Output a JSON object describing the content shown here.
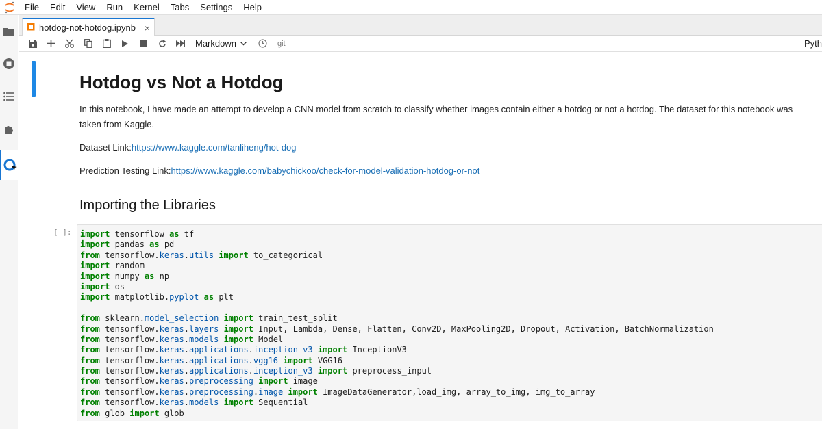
{
  "menu": [
    "File",
    "Edit",
    "View",
    "Run",
    "Kernel",
    "Tabs",
    "Settings",
    "Help"
  ],
  "tab": {
    "title": "hotdog-not-hotdog.ipynb",
    "close": "×"
  },
  "toolbar": {
    "cell_type": "Markdown",
    "git_label": "git",
    "kernel": "Pyth"
  },
  "icons": {
    "sidebar": [
      "folder-icon",
      "running-icon",
      "toc-icon",
      "extension-icon",
      "git-icon"
    ],
    "toolbar": [
      "save-icon",
      "add-icon",
      "cut-icon",
      "copy-icon",
      "paste-icon",
      "run-icon",
      "stop-icon",
      "restart-icon",
      "fast-forward-icon",
      "clock-icon"
    ]
  },
  "colors": {
    "accent": "#1976d2",
    "link": "#1a6fb5",
    "keyword": "#008000",
    "module": "#0055aa"
  },
  "cells": {
    "heading": "Hotdog vs Not a Hotdog",
    "intro_line1": "In this notebook, I have made an attempt to develop a CNN model from scratch to classify whether images contain either a hotdog or not a hotdog. The dataset for this notebook was",
    "intro_line2": "taken from Kaggle.",
    "dataset_label": "Dataset Link:",
    "dataset_url": "https://www.kaggle.com/tanliheng/hot-dog",
    "prediction_label": "Prediction Testing Link:",
    "prediction_url": "https://www.kaggle.com/babychickoo/check-for-model-validation-hotdog-or-not",
    "section_heading": "Importing the Libraries",
    "prompt": "[ ]:",
    "code_lines": [
      [
        [
          "kw",
          "import"
        ],
        [
          "t",
          " tensorflow "
        ],
        [
          "kw",
          "as"
        ],
        [
          "t",
          " tf"
        ]
      ],
      [
        [
          "kw",
          "import"
        ],
        [
          "t",
          " pandas "
        ],
        [
          "kw",
          "as"
        ],
        [
          "t",
          " pd"
        ]
      ],
      [
        [
          "kw",
          "from"
        ],
        [
          "t",
          " tensorflow."
        ],
        [
          "mod",
          "keras"
        ],
        [
          "t",
          "."
        ],
        [
          "mod",
          "utils"
        ],
        [
          "t",
          " "
        ],
        [
          "kw",
          "import"
        ],
        [
          "t",
          " to_categorical"
        ]
      ],
      [
        [
          "kw",
          "import"
        ],
        [
          "t",
          " random"
        ]
      ],
      [
        [
          "kw",
          "import"
        ],
        [
          "t",
          " numpy "
        ],
        [
          "kw",
          "as"
        ],
        [
          "t",
          " np"
        ]
      ],
      [
        [
          "kw",
          "import"
        ],
        [
          "t",
          " os"
        ]
      ],
      [
        [
          "kw",
          "import"
        ],
        [
          "t",
          " matplotlib."
        ],
        [
          "mod",
          "pyplot"
        ],
        [
          "t",
          " "
        ],
        [
          "kw",
          "as"
        ],
        [
          "t",
          " plt"
        ]
      ],
      [],
      [
        [
          "kw",
          "from"
        ],
        [
          "t",
          " sklearn."
        ],
        [
          "mod",
          "model_selection"
        ],
        [
          "t",
          " "
        ],
        [
          "kw",
          "import"
        ],
        [
          "t",
          " train_test_split"
        ]
      ],
      [
        [
          "kw",
          "from"
        ],
        [
          "t",
          " tensorflow."
        ],
        [
          "mod",
          "keras"
        ],
        [
          "t",
          "."
        ],
        [
          "mod",
          "layers"
        ],
        [
          "t",
          " "
        ],
        [
          "kw",
          "import"
        ],
        [
          "t",
          " Input, Lambda, Dense, Flatten, Conv2D, MaxPooling2D, Dropout, Activation, BatchNormalization"
        ]
      ],
      [
        [
          "kw",
          "from"
        ],
        [
          "t",
          " tensorflow."
        ],
        [
          "mod",
          "keras"
        ],
        [
          "t",
          "."
        ],
        [
          "mod",
          "models"
        ],
        [
          "t",
          " "
        ],
        [
          "kw",
          "import"
        ],
        [
          "t",
          " Model"
        ]
      ],
      [
        [
          "kw",
          "from"
        ],
        [
          "t",
          " tensorflow."
        ],
        [
          "mod",
          "keras"
        ],
        [
          "t",
          "."
        ],
        [
          "mod",
          "applications"
        ],
        [
          "t",
          "."
        ],
        [
          "mod",
          "inception_v3"
        ],
        [
          "t",
          " "
        ],
        [
          "kw",
          "import"
        ],
        [
          "t",
          " InceptionV3"
        ]
      ],
      [
        [
          "kw",
          "from"
        ],
        [
          "t",
          " tensorflow."
        ],
        [
          "mod",
          "keras"
        ],
        [
          "t",
          "."
        ],
        [
          "mod",
          "applications"
        ],
        [
          "t",
          "."
        ],
        [
          "mod",
          "vgg16"
        ],
        [
          "t",
          " "
        ],
        [
          "kw",
          "import"
        ],
        [
          "t",
          " VGG16"
        ]
      ],
      [
        [
          "kw",
          "from"
        ],
        [
          "t",
          " tensorflow."
        ],
        [
          "mod",
          "keras"
        ],
        [
          "t",
          "."
        ],
        [
          "mod",
          "applications"
        ],
        [
          "t",
          "."
        ],
        [
          "mod",
          "inception_v3"
        ],
        [
          "t",
          " "
        ],
        [
          "kw",
          "import"
        ],
        [
          "t",
          " preprocess_input"
        ]
      ],
      [
        [
          "kw",
          "from"
        ],
        [
          "t",
          " tensorflow."
        ],
        [
          "mod",
          "keras"
        ],
        [
          "t",
          "."
        ],
        [
          "mod",
          "preprocessing"
        ],
        [
          "t",
          " "
        ],
        [
          "kw",
          "import"
        ],
        [
          "t",
          " image"
        ]
      ],
      [
        [
          "kw",
          "from"
        ],
        [
          "t",
          " tensorflow."
        ],
        [
          "mod",
          "keras"
        ],
        [
          "t",
          "."
        ],
        [
          "mod",
          "preprocessing"
        ],
        [
          "t",
          "."
        ],
        [
          "mod",
          "image"
        ],
        [
          "t",
          " "
        ],
        [
          "kw",
          "import"
        ],
        [
          "t",
          " ImageDataGenerator,load_img, array_to_img, img_to_array"
        ]
      ],
      [
        [
          "kw",
          "from"
        ],
        [
          "t",
          " tensorflow."
        ],
        [
          "mod",
          "keras"
        ],
        [
          "t",
          "."
        ],
        [
          "mod",
          "models"
        ],
        [
          "t",
          " "
        ],
        [
          "kw",
          "import"
        ],
        [
          "t",
          " Sequential"
        ]
      ],
      [
        [
          "kw",
          "from"
        ],
        [
          "t",
          " glob "
        ],
        [
          "kw",
          "import"
        ],
        [
          "t",
          " glob"
        ]
      ]
    ]
  }
}
